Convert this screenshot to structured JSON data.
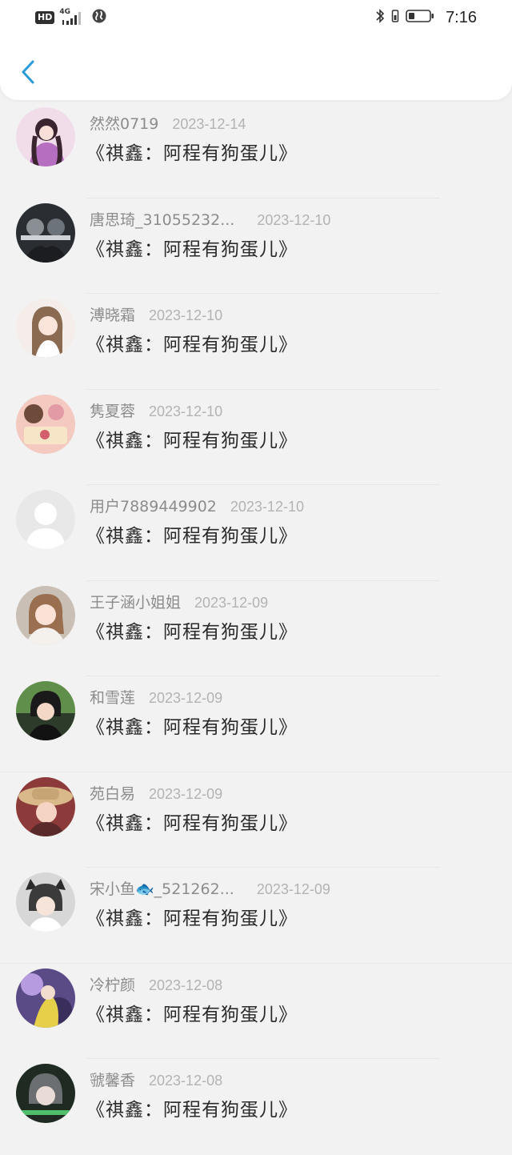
{
  "status_bar": {
    "hd": "HD",
    "network": "4G",
    "time": "7:16"
  },
  "header": {
    "back_icon": "chevron-left-icon",
    "accent_color": "#2a9bd8"
  },
  "list": [
    {
      "user": "然然0719",
      "date": "2023-12-14",
      "title": "《祺鑫：阿程有狗蛋儿》"
    },
    {
      "user": "唐思琦_31055232...",
      "date": "2023-12-10",
      "title": "《祺鑫：阿程有狗蛋儿》"
    },
    {
      "user": "溥晓霜",
      "date": "2023-12-10",
      "title": "《祺鑫：阿程有狗蛋儿》"
    },
    {
      "user": "隽夏蓉",
      "date": "2023-12-10",
      "title": "《祺鑫：阿程有狗蛋儿》"
    },
    {
      "user": "用户7889449902",
      "date": "2023-12-10",
      "title": "《祺鑫：阿程有狗蛋儿》"
    },
    {
      "user": "王子涵小姐姐",
      "date": "2023-12-09",
      "title": "《祺鑫：阿程有狗蛋儿》"
    },
    {
      "user": "和雪莲",
      "date": "2023-12-09",
      "title": "《祺鑫：阿程有狗蛋儿》"
    },
    {
      "user": "苑白易",
      "date": "2023-12-09",
      "title": "《祺鑫：阿程有狗蛋儿》"
    },
    {
      "user": "宋小鱼🐟_521262...",
      "date": "2023-12-09",
      "title": "《祺鑫：阿程有狗蛋儿》"
    },
    {
      "user": "冷柠颜",
      "date": "2023-12-08",
      "title": "《祺鑫：阿程有狗蛋儿》"
    },
    {
      "user": "虢馨香",
      "date": "2023-12-08",
      "title": "《祺鑫：阿程有狗蛋儿》"
    }
  ]
}
